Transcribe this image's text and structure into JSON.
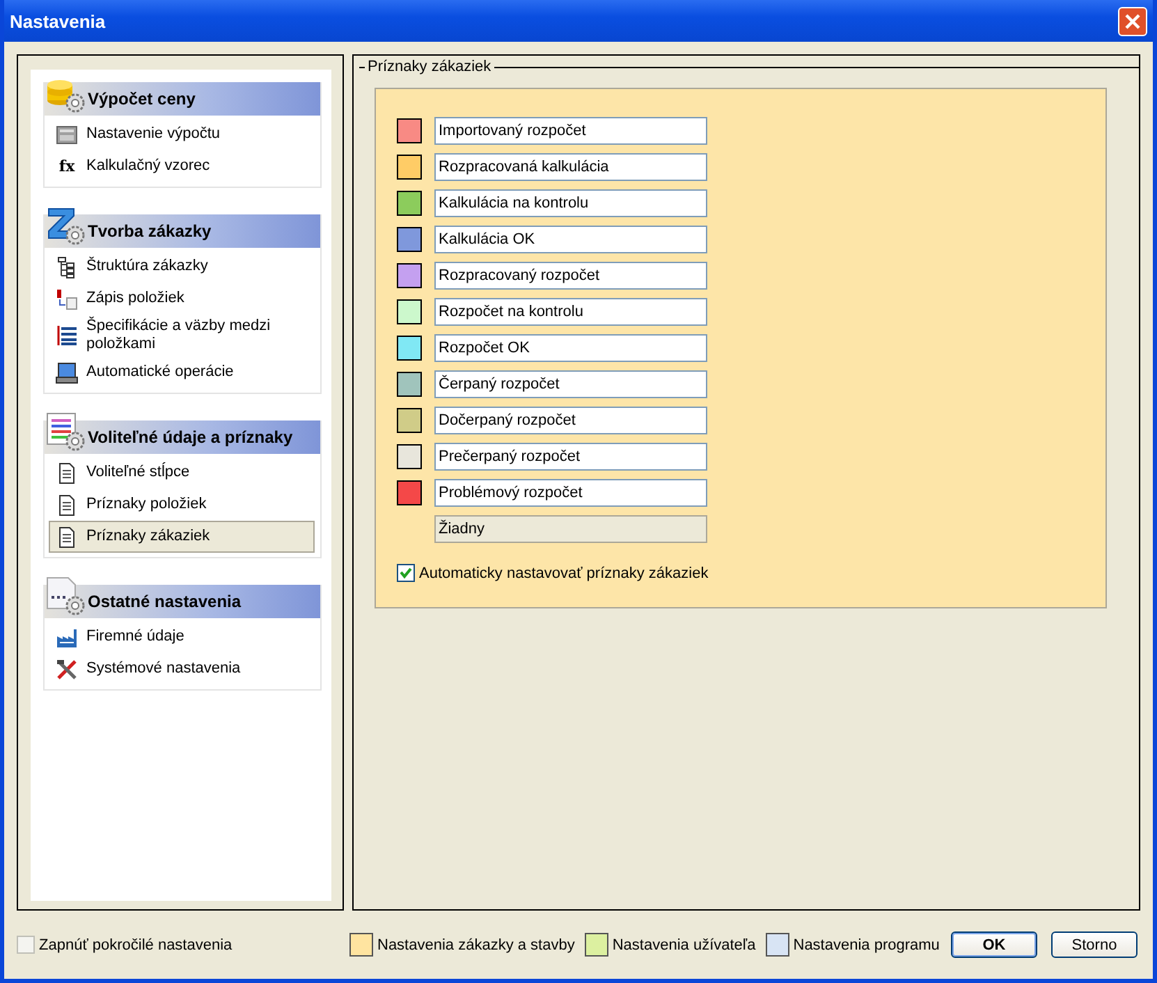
{
  "window": {
    "title": "Nastavenia"
  },
  "sidebar": {
    "sections": [
      {
        "title": "Výpočet ceny",
        "items": [
          {
            "label": "Nastavenie výpočtu",
            "selected": false
          },
          {
            "label": "Kalkulačný vzorec",
            "selected": false,
            "icon_text": "fx"
          }
        ]
      },
      {
        "title": "Tvorba zákazky",
        "items": [
          {
            "label": "Štruktúra zákazky",
            "selected": false
          },
          {
            "label": "Zápis položiek",
            "selected": false
          },
          {
            "label": "Špecifikácie a väzby medzi položkami",
            "selected": false
          },
          {
            "label": "Automatické operácie",
            "selected": false
          }
        ]
      },
      {
        "title": "Voliteľné údaje a príznaky",
        "items": [
          {
            "label": "Voliteľné stĺpce",
            "selected": false
          },
          {
            "label": "Príznaky položiek",
            "selected": false
          },
          {
            "label": "Príznaky zákaziek",
            "selected": true
          }
        ]
      },
      {
        "title": "Ostatné nastavenia",
        "items": [
          {
            "label": "Firemné údaje",
            "selected": false
          },
          {
            "label": "Systémové nastavenia",
            "selected": false
          }
        ]
      }
    ]
  },
  "group": {
    "title": "Príznaky zákaziek",
    "flags": [
      {
        "kind": "color",
        "color": "#f88a84",
        "value": "Importovaný rozpočet"
      },
      {
        "kind": "color",
        "color": "#ffcc66",
        "value": "Rozpracovaná kalkulácia"
      },
      {
        "kind": "color",
        "color": "#8ccc5c",
        "value": "Kalkulácia na kontrolu"
      },
      {
        "kind": "color",
        "color": "#7f98dc",
        "value": "Kalkulácia OK"
      },
      {
        "kind": "color",
        "color": "#c4a0f0",
        "value": "Rozpracovaný rozpočet"
      },
      {
        "kind": "color",
        "color": "#ccf8cc",
        "value": "Rozpočet na kontrolu"
      },
      {
        "kind": "color",
        "color": "#80e8f4",
        "value": "Rozpočet OK"
      },
      {
        "kind": "color",
        "color": "#a0c4bc",
        "value": "Čerpaný rozpočet"
      },
      {
        "kind": "color",
        "color": "#d0cc88",
        "value": "Dočerpaný rozpočet"
      },
      {
        "kind": "color",
        "color": "#e8e6dc",
        "value": "Prečerpaný rozpočet"
      },
      {
        "kind": "color",
        "color": "#f44848",
        "value": "Problémový rozpočet"
      },
      {
        "kind": "none",
        "value": "Žiadny"
      }
    ],
    "auto": {
      "label": "Automaticky nastavovať príznaky zákaziek",
      "checked": true
    }
  },
  "footer": {
    "advanced": {
      "label": "Zapnúť pokročilé nastavenia",
      "checked": false,
      "disabled": true
    },
    "legend": [
      {
        "label": "Nastavenia zákazky a stavby",
        "color": "#ffe4a0"
      },
      {
        "label": "Nastavenia užívateľa",
        "color": "#dcf0a0"
      },
      {
        "label": "Nastavenia programu",
        "color": "#d8e4f4"
      }
    ],
    "buttons": [
      {
        "label": "OK",
        "default": true
      },
      {
        "label": "Storno",
        "default": false
      }
    ]
  }
}
